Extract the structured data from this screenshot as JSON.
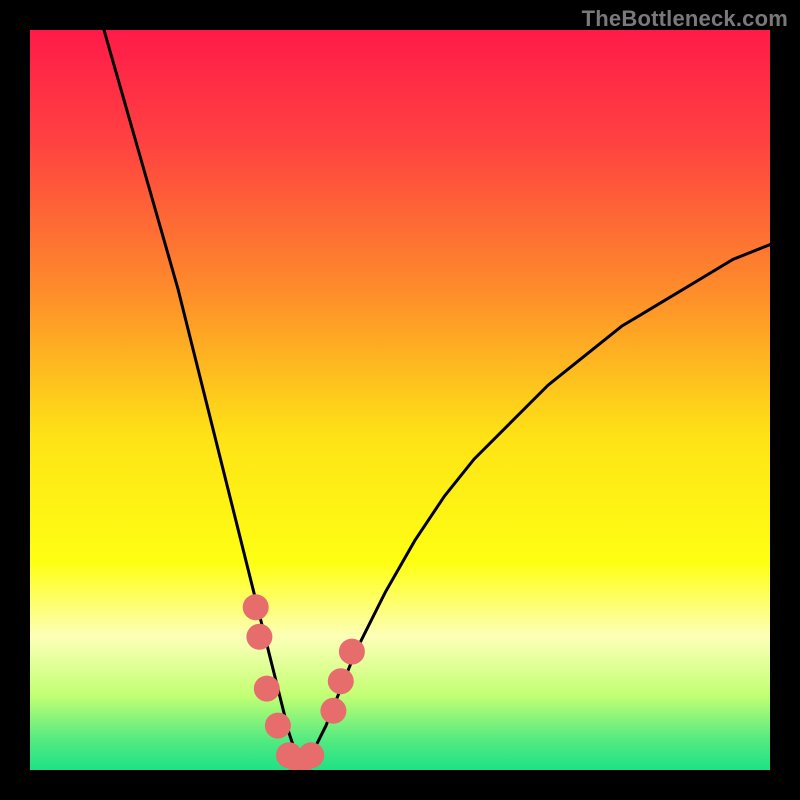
{
  "watermark": "TheBottleneck.com",
  "chart_data": {
    "type": "line",
    "title": "",
    "xlabel": "",
    "ylabel": "",
    "xlim": [
      0,
      100
    ],
    "ylim": [
      0,
      100
    ],
    "series": [
      {
        "name": "bottleneck-curve",
        "x": [
          10,
          12,
          14,
          16,
          18,
          20,
          22,
          24,
          26,
          28,
          30,
          32,
          33,
          34,
          35,
          36,
          37,
          38,
          40,
          42,
          44,
          48,
          52,
          56,
          60,
          65,
          70,
          75,
          80,
          85,
          90,
          95,
          100
        ],
        "y": [
          100,
          93,
          86,
          79,
          72,
          65,
          57,
          49,
          41,
          33,
          25,
          17,
          13,
          9,
          5,
          2,
          1,
          2,
          6,
          11,
          16,
          24,
          31,
          37,
          42,
          47,
          52,
          56,
          60,
          63,
          66,
          69,
          71
        ]
      }
    ],
    "markers": {
      "name": "highlighted-points",
      "color": "#e66d6b",
      "points": [
        {
          "x": 30.5,
          "y": 22
        },
        {
          "x": 31.0,
          "y": 18
        },
        {
          "x": 32.0,
          "y": 11
        },
        {
          "x": 33.5,
          "y": 6
        },
        {
          "x": 35.0,
          "y": 2
        },
        {
          "x": 36.5,
          "y": 1
        },
        {
          "x": 38.0,
          "y": 2
        },
        {
          "x": 41.0,
          "y": 8
        },
        {
          "x": 42.0,
          "y": 12
        },
        {
          "x": 43.5,
          "y": 16
        }
      ]
    },
    "gradient_background": {
      "stops": [
        {
          "offset": 0.0,
          "color": "#ff1b49"
        },
        {
          "offset": 0.15,
          "color": "#ff4141"
        },
        {
          "offset": 0.35,
          "color": "#fe8b2b"
        },
        {
          "offset": 0.55,
          "color": "#fee316"
        },
        {
          "offset": 0.72,
          "color": "#feff13"
        },
        {
          "offset": 0.82,
          "color": "#fdffb8"
        },
        {
          "offset": 0.9,
          "color": "#c1ff73"
        },
        {
          "offset": 0.96,
          "color": "#52ea81"
        },
        {
          "offset": 1.0,
          "color": "#1de285"
        }
      ]
    }
  }
}
